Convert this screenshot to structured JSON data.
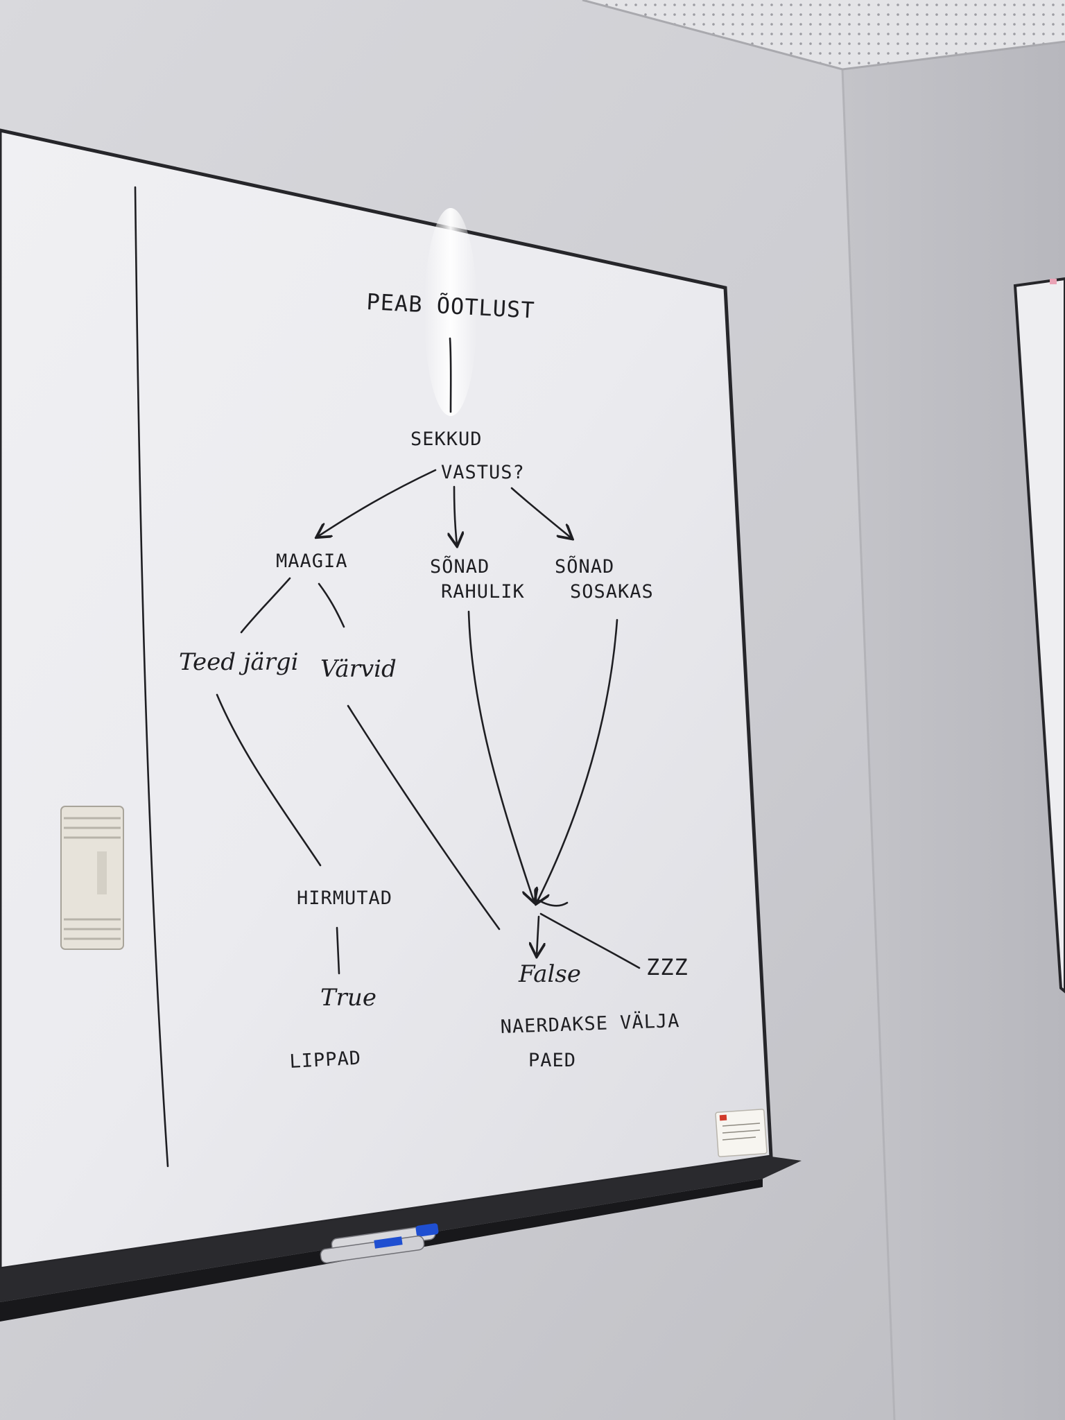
{
  "nodes": {
    "root": "PEAB ÕOTLUST",
    "sekkud": "SEKKUD",
    "vastus": "VASTUS?",
    "maagia": "MAAGIA",
    "sonad_rahulik_1": "SÕNAD",
    "sonad_rahulik_2": "RAHULIK",
    "sonad_sosakas_1": "SÕNAD",
    "sonad_sosakas_2": "SOSAKAS",
    "teed_jargi": "Teed järgi",
    "varvid": "Värvid",
    "hirmutad": "HIRMUTAD",
    "true_label": "True",
    "lippad": "LIPPAD",
    "false_label": "False",
    "zzz": "ZZZ",
    "naerdakse_1": "NAERDAKSE VÄLJA",
    "naerdakse_2": "PAED"
  },
  "colors": {
    "wall": "#cfcfd3",
    "board": "#f4f4f6",
    "frame": "#26262a",
    "ink": "#1e1e22",
    "marker_blue": "#1f4fd1"
  },
  "objects": {
    "eraser": "eraser-icon",
    "markers": "marker-icon",
    "sticker": "label-sticker-icon"
  }
}
